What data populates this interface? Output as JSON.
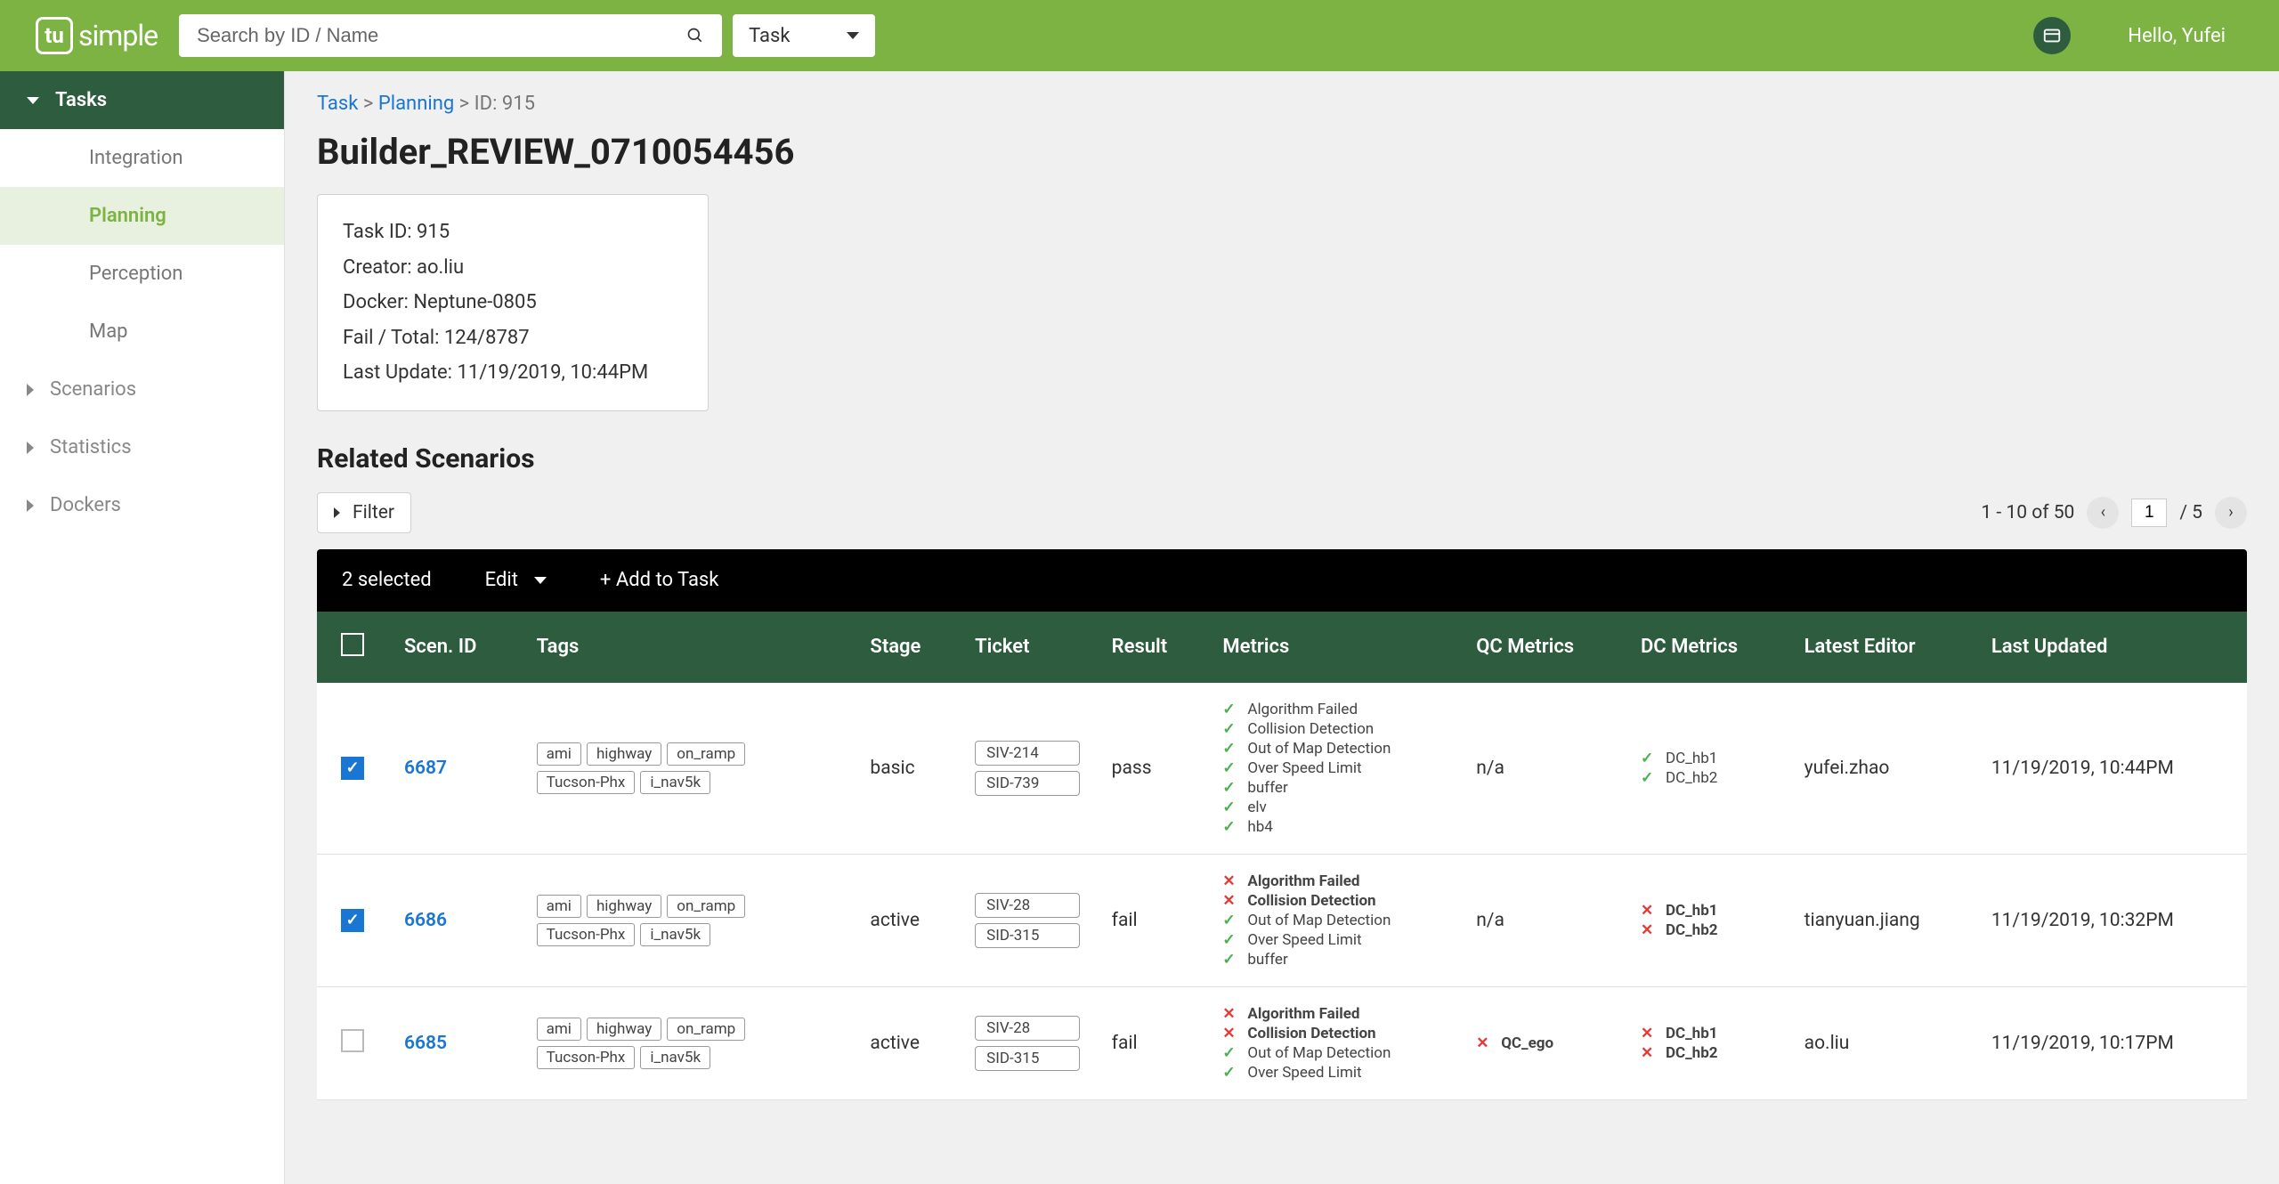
{
  "brand": {
    "mark": "tu",
    "text": "simple"
  },
  "header": {
    "search_placeholder": "Search by ID / Name",
    "task_dd": "Task",
    "greeting": "Hello, Yufei"
  },
  "sidebar": {
    "tasks": {
      "label": "Tasks",
      "items": [
        "Integration",
        "Planning",
        "Perception",
        "Map"
      ]
    },
    "scenarios": "Scenarios",
    "statistics": "Statistics",
    "dockers": "Dockers"
  },
  "breadcrumb": {
    "task": "Task",
    "planning": "Planning",
    "id": "ID: 915",
    "sep": ">"
  },
  "page_title": "Builder_REVIEW_0710054456",
  "info": {
    "task_id": "Task ID: 915",
    "creator": "Creator: ao.liu",
    "docker": "Docker: Neptune-0805",
    "fail_total": "Fail / Total: 124/8787",
    "last_update": "Last Update: 11/19/2019, 10:44PM"
  },
  "section_title": "Related Scenarios",
  "filter_label": "Filter",
  "pagination": {
    "range": "1 - 10 of 50",
    "page": "1",
    "total": "/ 5"
  },
  "action_bar": {
    "selected": "2 selected",
    "edit": "Edit",
    "add": "+ Add to Task"
  },
  "columns": [
    "",
    "Scen. ID",
    "Tags",
    "Stage",
    "Ticket",
    "Result",
    "Metrics",
    "QC Metrics",
    "DC Metrics",
    "Latest Editor",
    "Last Updated"
  ],
  "rows": [
    {
      "checked": true,
      "id": "6687",
      "tags": [
        "ami",
        "highway",
        "on_ramp",
        "Tucson-Phx",
        "i_nav5k"
      ],
      "stage": "basic",
      "tickets": [
        "SIV-214",
        "SID-739"
      ],
      "result": "pass",
      "metrics": [
        {
          "label": "Algorithm Failed",
          "pass": true
        },
        {
          "label": "Collision Detection",
          "pass": true
        },
        {
          "label": "Out of Map Detection",
          "pass": true
        },
        {
          "label": "Over Speed Limit",
          "pass": true
        },
        {
          "label": "buffer",
          "pass": true
        },
        {
          "label": "elv",
          "pass": true
        },
        {
          "label": "hb4",
          "pass": true
        }
      ],
      "qc": "n/a",
      "dc": [
        {
          "label": "DC_hb1",
          "pass": true
        },
        {
          "label": "DC_hb2",
          "pass": true
        }
      ],
      "editor": "yufei.zhao",
      "updated": "11/19/2019, 10:44PM"
    },
    {
      "checked": true,
      "id": "6686",
      "tags": [
        "ami",
        "highway",
        "on_ramp",
        "Tucson-Phx",
        "i_nav5k"
      ],
      "stage": "active",
      "tickets": [
        "SIV-28",
        "SID-315"
      ],
      "result": "fail",
      "metrics": [
        {
          "label": "Algorithm Failed",
          "pass": false
        },
        {
          "label": "Collision Detection",
          "pass": false
        },
        {
          "label": "Out of Map Detection",
          "pass": true
        },
        {
          "label": "Over Speed Limit",
          "pass": true
        },
        {
          "label": "buffer",
          "pass": true
        }
      ],
      "qc": "n/a",
      "dc": [
        {
          "label": "DC_hb1",
          "pass": false
        },
        {
          "label": "DC_hb2",
          "pass": false
        }
      ],
      "editor": "tianyuan.jiang",
      "updated": "11/19/2019, 10:32PM"
    },
    {
      "checked": false,
      "id": "6685",
      "tags": [
        "ami",
        "highway",
        "on_ramp",
        "Tucson-Phx",
        "i_nav5k"
      ],
      "stage": "active",
      "tickets": [
        "SIV-28",
        "SID-315"
      ],
      "result": "fail",
      "metrics": [
        {
          "label": "Algorithm Failed",
          "pass": false
        },
        {
          "label": "Collision Detection",
          "pass": false
        },
        {
          "label": "Out of Map Detection",
          "pass": true
        },
        {
          "label": "Over Speed Limit",
          "pass": true
        }
      ],
      "qc_metrics": [
        {
          "label": "QC_ego",
          "pass": false
        }
      ],
      "dc": [
        {
          "label": "DC_hb1",
          "pass": false
        },
        {
          "label": "DC_hb2",
          "pass": false
        }
      ],
      "editor": "ao.liu",
      "updated": "11/19/2019, 10:17PM"
    }
  ]
}
